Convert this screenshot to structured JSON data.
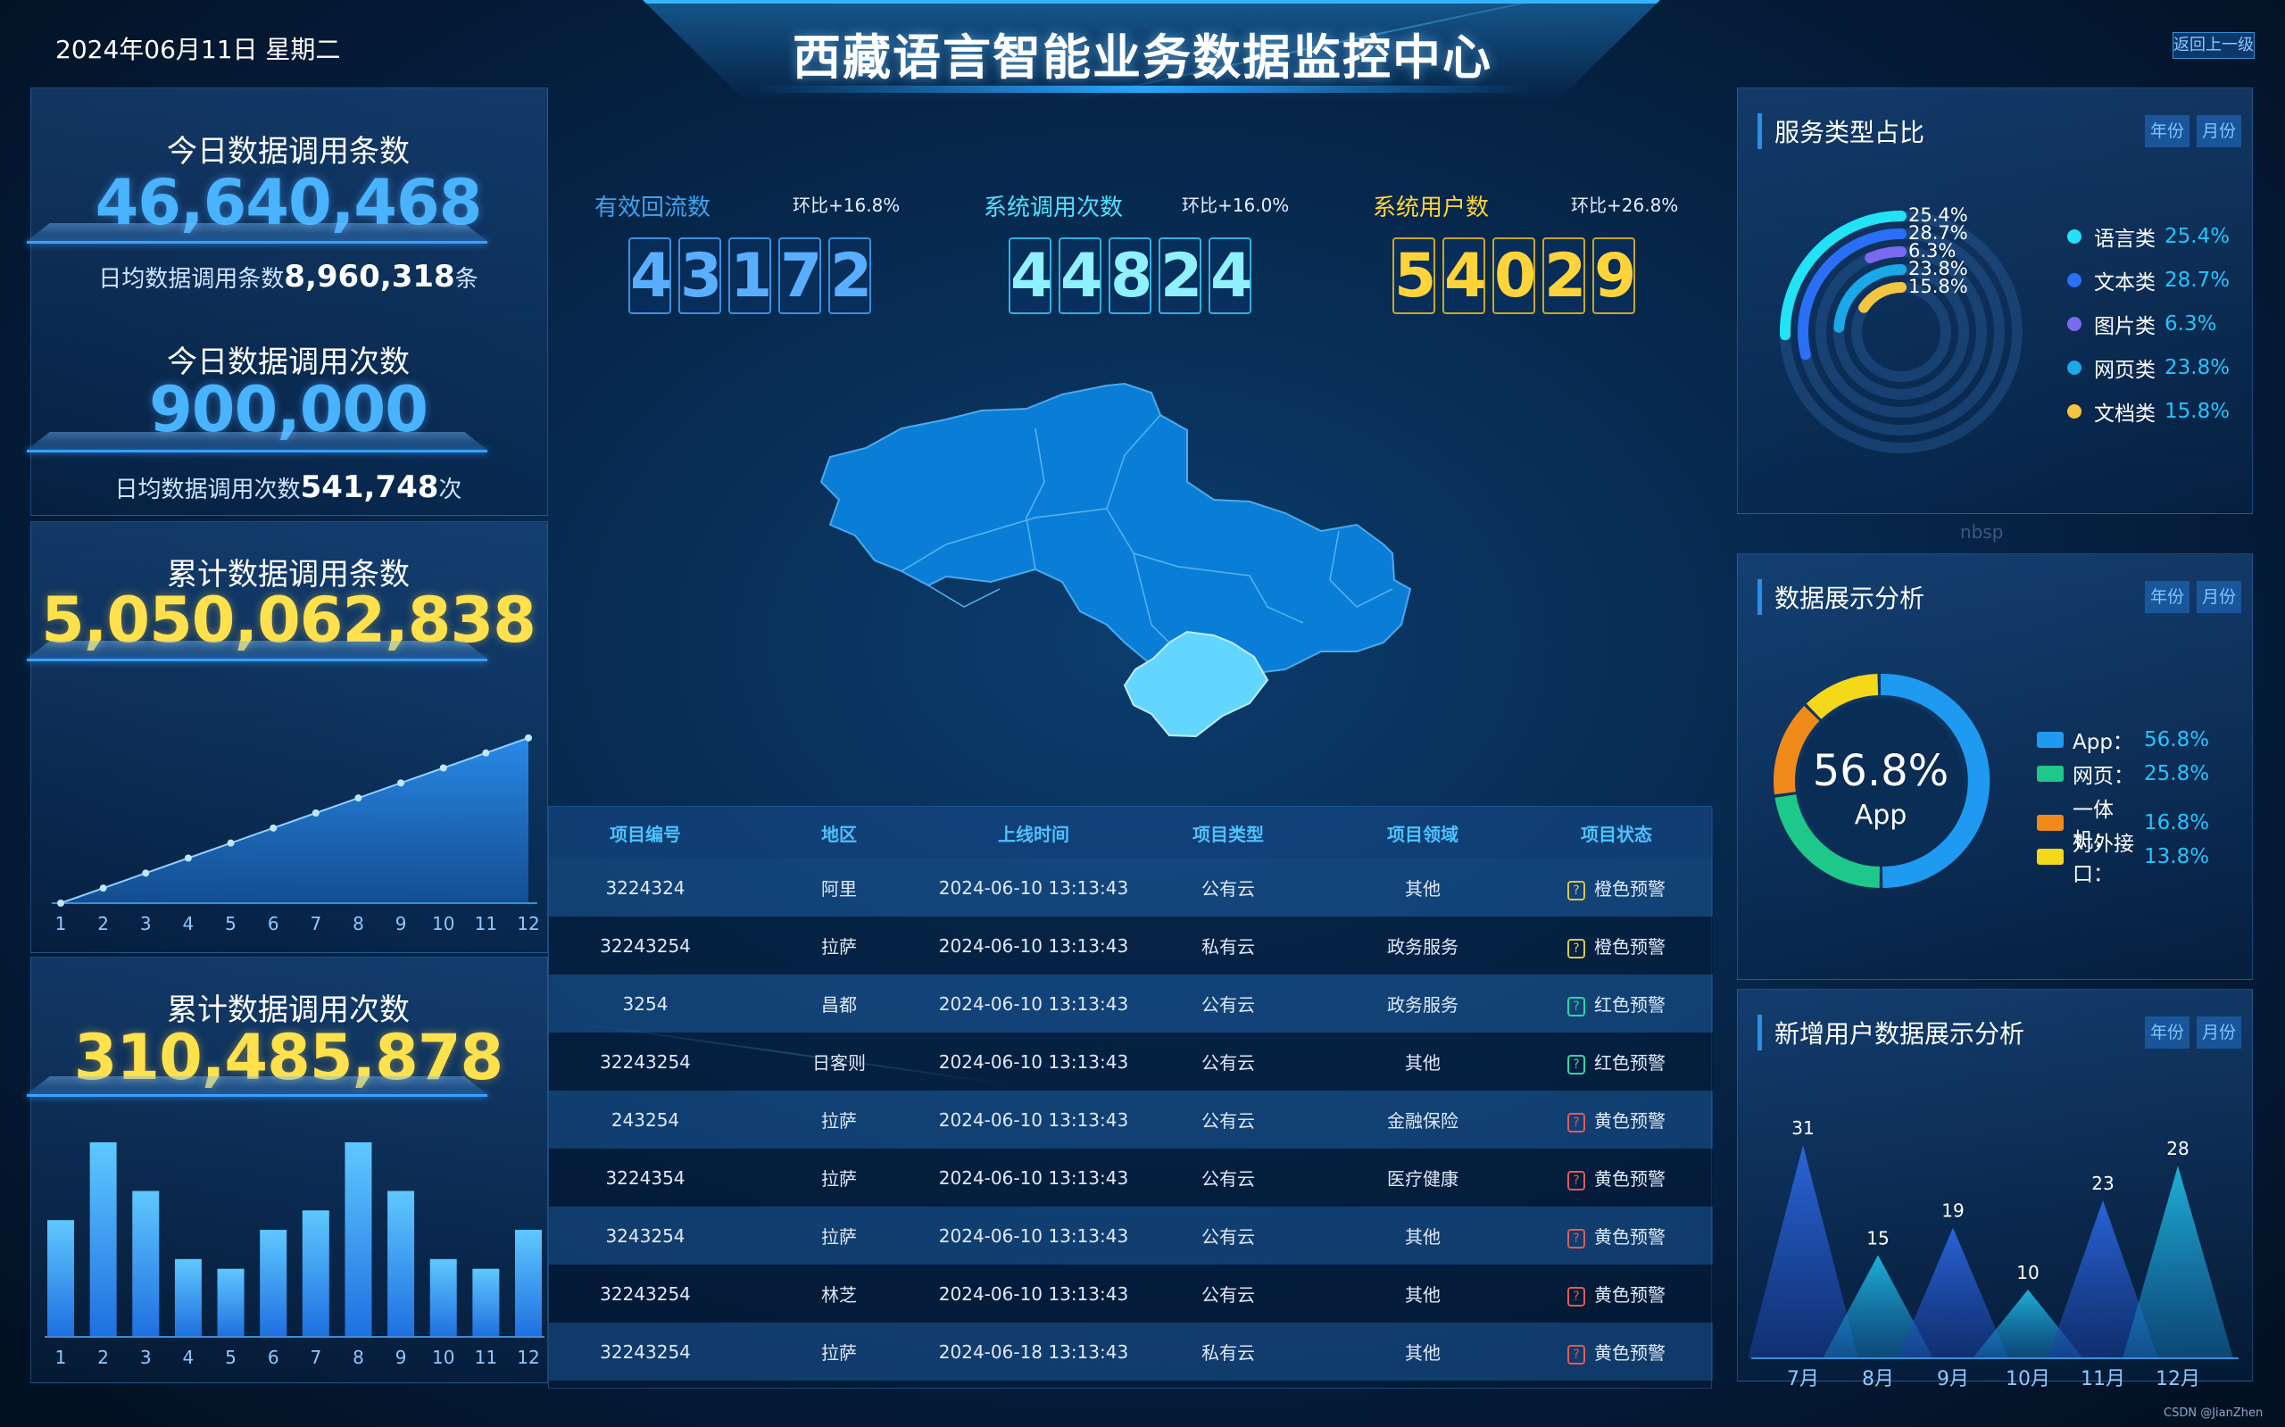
{
  "header": {
    "datetime": "2024年06月11日 星期二",
    "title": "西藏语言智能业务数据监控中心",
    "back_button": "返回上一级"
  },
  "left": {
    "today_calls_label": "今日数据调用条数",
    "today_calls_value": "46,640,468",
    "daily_avg_calls_prefix": "日均数据调用条数",
    "daily_avg_calls_value": "8,960,318",
    "daily_avg_calls_suffix": "条",
    "today_times_label": "今日数据调用次数",
    "today_times_value": "900,000",
    "daily_avg_times_prefix": "日均数据调用次数",
    "daily_avg_times_value": "541,748",
    "daily_avg_times_suffix": "次",
    "cum_calls_label": "累计数据调用条数",
    "cum_calls_value": "5,050,062,838",
    "cum_times_label": "累计数据调用次数",
    "cum_times_value": "310,485,878"
  },
  "kpis": [
    {
      "label": "有效回流数",
      "change": "环比+16.8%",
      "digits": [
        "4",
        "3",
        "1",
        "7",
        "2"
      ],
      "color": "#3ba4f0"
    },
    {
      "label": "系统调用次数",
      "change": "环比+16.0%",
      "digits": [
        "4",
        "4",
        "8",
        "2",
        "4"
      ],
      "color": "#4fe0ff"
    },
    {
      "label": "系统用户数",
      "change": "环比+26.8%",
      "digits": [
        "5",
        "4",
        "0",
        "2",
        "9"
      ],
      "color": "#ffd43a"
    }
  ],
  "table": {
    "headers": [
      "项目编号",
      "地区",
      "上线时间",
      "项目类型",
      "项目领域",
      "项目状态"
    ],
    "rows": [
      [
        "3224324",
        "阿里",
        "2024-06-10 13:13:43",
        "公有云",
        "其他",
        "橙色预警"
      ],
      [
        "32243254",
        "拉萨",
        "2024-06-10 13:13:43",
        "私有云",
        "政务服务",
        "橙色预警"
      ],
      [
        "3254",
        "昌都",
        "2024-06-10 13:13:43",
        "公有云",
        "政务服务",
        "红色预警"
      ],
      [
        "32243254",
        "日客则",
        "2024-06-10 13:13:43",
        "公有云",
        "其他",
        "红色预警"
      ],
      [
        "243254",
        "拉萨",
        "2024-06-10 13:13:43",
        "公有云",
        "金融保险",
        "黄色预警"
      ],
      [
        "3224354",
        "拉萨",
        "2024-06-10 13:13:43",
        "公有云",
        "医疗健康",
        "黄色预警"
      ],
      [
        "3243254",
        "拉萨",
        "2024-06-10 13:13:43",
        "公有云",
        "其他",
        "黄色预警"
      ],
      [
        "32243254",
        "林芝",
        "2024-06-10 13:13:43",
        "公有云",
        "其他",
        "黄色预警"
      ],
      [
        "32243254",
        "拉萨",
        "2024-06-18 13:13:43",
        "私有云",
        "其他",
        "黄色预警"
      ]
    ]
  },
  "right": {
    "tab_year": "年份",
    "tab_month": "月份",
    "service_title": "服务类型占比",
    "service_legend": [
      {
        "name": "语言类",
        "value": "25.4%",
        "color": "#22e3f5"
      },
      {
        "name": "文本类",
        "value": "28.7%",
        "color": "#2a6ff5"
      },
      {
        "name": "图片类",
        "value": "6.3%",
        "color": "#7a6af0"
      },
      {
        "name": "网页类",
        "value": "23.8%",
        "color": "#1aa8e8"
      },
      {
        "name": "文档类",
        "value": "15.8%",
        "color": "#f5c542"
      }
    ],
    "ring_labels": [
      "25.4%",
      "28.7%",
      "6.3%",
      "23.8%",
      "15.8%"
    ],
    "nbsp": "nbsp",
    "display_title": "数据展示分析",
    "donut_center_value": "56.8%",
    "donut_center_label": "App",
    "display_legend": [
      {
        "name": "App：",
        "value": "56.8%",
        "color": "#1e9bf0"
      },
      {
        "name": "网页：",
        "value": "25.8%",
        "color": "#1ec88a"
      },
      {
        "name": "一体机：",
        "value": "16.8%",
        "color": "#f08a1a"
      },
      {
        "name": "对外接口：",
        "value": "13.8%",
        "color": "#f5d81a"
      }
    ],
    "users_title": "新增用户数据展示分析"
  },
  "chart_data": [
    {
      "type": "area",
      "x": [
        "1",
        "2",
        "3",
        "4",
        "5",
        "6",
        "7",
        "8",
        "9",
        "10",
        "11",
        "12"
      ],
      "values": [
        0,
        1,
        2,
        3,
        4,
        5,
        6,
        7,
        8,
        9,
        10,
        11
      ],
      "ylim": [
        0,
        12
      ]
    },
    {
      "type": "bar",
      "categories": [
        "1",
        "2",
        "3",
        "4",
        "5",
        "6",
        "7",
        "8",
        "9",
        "10",
        "11",
        "12"
      ],
      "values": [
        6,
        10,
        7.5,
        4,
        3.5,
        5.5,
        6.5,
        10,
        7.5,
        4,
        3.5,
        5.5
      ],
      "ylim": [
        0,
        10
      ]
    },
    {
      "type": "pie",
      "labels": [
        "语言类",
        "文本类",
        "图片类",
        "网页类",
        "文档类"
      ],
      "values": [
        25.4,
        28.7,
        6.3,
        23.8,
        15.8
      ]
    },
    {
      "type": "pie",
      "labels": [
        "App",
        "网页",
        "一体机",
        "对外接口"
      ],
      "values": [
        56.8,
        25.8,
        16.8,
        13.8
      ]
    },
    {
      "type": "area",
      "categories": [
        "7月",
        "8月",
        "9月",
        "10月",
        "11月",
        "12月"
      ],
      "series": [
        {
          "values": [
            31,
            15,
            19,
            10,
            23,
            28
          ]
        }
      ],
      "ylim": [
        0,
        34
      ]
    }
  ],
  "footer": {
    "watermark": "CSDN @JianZhen"
  }
}
